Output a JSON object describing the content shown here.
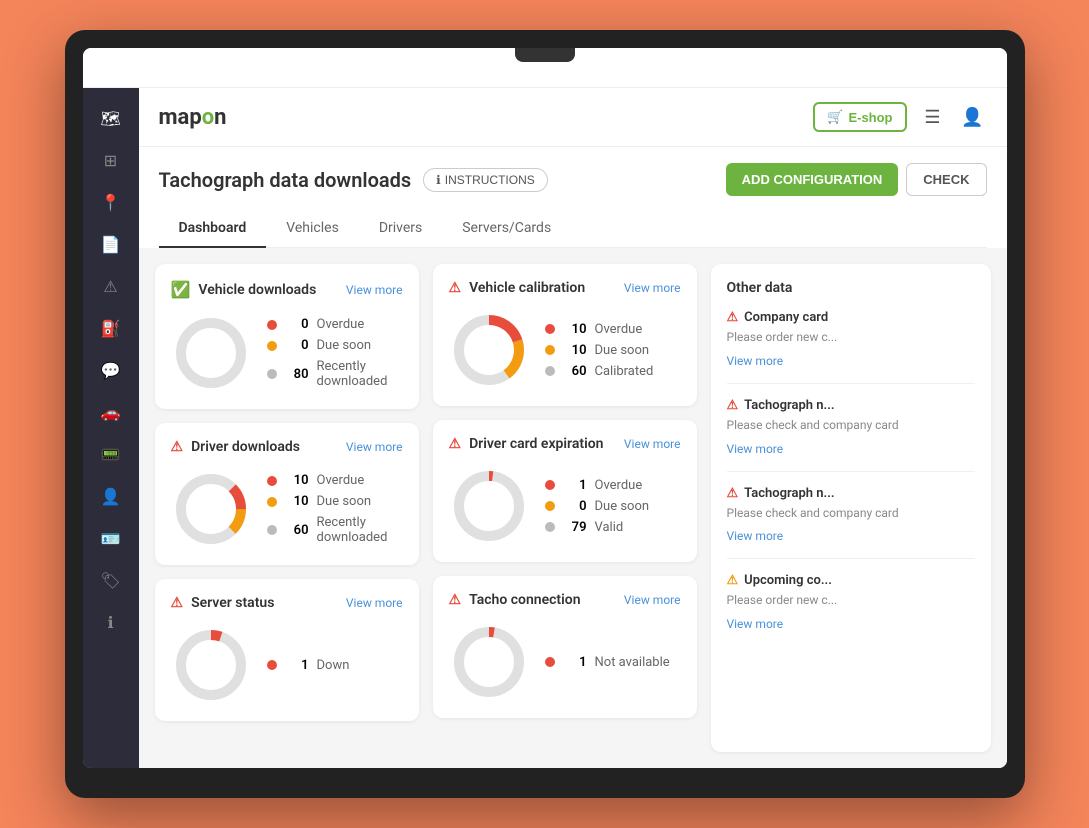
{
  "app": {
    "name": "mapon",
    "eshop_label": "E-shop"
  },
  "header": {
    "title": "Tachograph data downloads",
    "instructions_label": "INSTRUCTIONS",
    "add_config_label": "ADD CONFIGURATION",
    "check_label": "CHECK"
  },
  "tabs": [
    {
      "label": "Dashboard",
      "active": true
    },
    {
      "label": "Vehicles",
      "active": false
    },
    {
      "label": "Drivers",
      "active": false
    },
    {
      "label": "Servers/Cards",
      "active": false
    }
  ],
  "sidebar": {
    "icons": [
      {
        "name": "map-icon",
        "symbol": "🗺"
      },
      {
        "name": "dashboard-icon",
        "symbol": "⊞"
      },
      {
        "name": "location-icon",
        "symbol": "📍"
      },
      {
        "name": "file-icon",
        "symbol": "📄"
      },
      {
        "name": "alert-circle-icon",
        "symbol": "⚠"
      },
      {
        "name": "fuel-icon",
        "symbol": "⛽"
      },
      {
        "name": "chat-icon",
        "symbol": "💬"
      },
      {
        "name": "car-icon",
        "symbol": "🚗"
      },
      {
        "name": "tacho-icon",
        "symbol": "📟"
      },
      {
        "name": "user-icon",
        "symbol": "👤"
      },
      {
        "name": "id-icon",
        "symbol": "🪪"
      },
      {
        "name": "tag-icon",
        "symbol": "🏷"
      },
      {
        "name": "info-icon",
        "symbol": "ℹ"
      }
    ]
  },
  "cards": {
    "vehicle_downloads": {
      "title": "Vehicle downloads",
      "view_more": "View more",
      "status": "ok",
      "stats": [
        {
          "color": "red",
          "value": "0",
          "label": "Overdue"
        },
        {
          "color": "orange",
          "value": "0",
          "label": "Due soon"
        },
        {
          "color": "gray",
          "value": "80",
          "label": "Recently downloaded"
        }
      ],
      "donut": {
        "segments": [
          {
            "color": "#e0e0e0",
            "percent": 100
          }
        ]
      }
    },
    "vehicle_calibration": {
      "title": "Vehicle calibration",
      "view_more": "View more",
      "status": "alert",
      "stats": [
        {
          "color": "red",
          "value": "10",
          "label": "Overdue"
        },
        {
          "color": "orange",
          "value": "10",
          "label": "Due soon"
        },
        {
          "color": "gray",
          "value": "60",
          "label": "Calibrated"
        }
      ]
    },
    "driver_downloads": {
      "title": "Driver downloads",
      "view_more": "View more",
      "status": "alert",
      "stats": [
        {
          "color": "red",
          "value": "10",
          "label": "Overdue"
        },
        {
          "color": "orange",
          "value": "10",
          "label": "Due soon"
        },
        {
          "color": "gray",
          "value": "60",
          "label": "Recently downloaded"
        }
      ]
    },
    "driver_card_expiration": {
      "title": "Driver card expiration",
      "view_more": "View more",
      "status": "alert",
      "stats": [
        {
          "color": "red",
          "value": "1",
          "label": "Overdue"
        },
        {
          "color": "orange",
          "value": "0",
          "label": "Due soon"
        },
        {
          "color": "gray",
          "value": "79",
          "label": "Valid"
        }
      ]
    },
    "server_status": {
      "title": "Server status",
      "view_more": "View more",
      "status": "alert",
      "stats": [
        {
          "color": "red",
          "value": "1",
          "label": "Down"
        }
      ]
    },
    "tacho_connection": {
      "title": "Tacho connection",
      "view_more": "View more",
      "status": "alert",
      "stats": [
        {
          "color": "red",
          "value": "1",
          "label": "Not available"
        }
      ]
    }
  },
  "other_data": {
    "title": "Other data",
    "items": [
      {
        "icon": "alert",
        "icon_color": "#e74c3c",
        "title": "Company card",
        "description": "Please order new c...",
        "view_more": "View more"
      },
      {
        "icon": "alert",
        "icon_color": "#e74c3c",
        "title": "Tachograph n...",
        "description": "Please check and company card",
        "view_more": "View more"
      },
      {
        "icon": "alert",
        "icon_color": "#e74c3c",
        "title": "Tachograph n...",
        "description": "Please check and company card",
        "view_more": "View more"
      },
      {
        "icon": "warn",
        "icon_color": "#f39c12",
        "title": "Upcoming co...",
        "description": "Please order new c...",
        "view_more": "View more"
      }
    ]
  }
}
